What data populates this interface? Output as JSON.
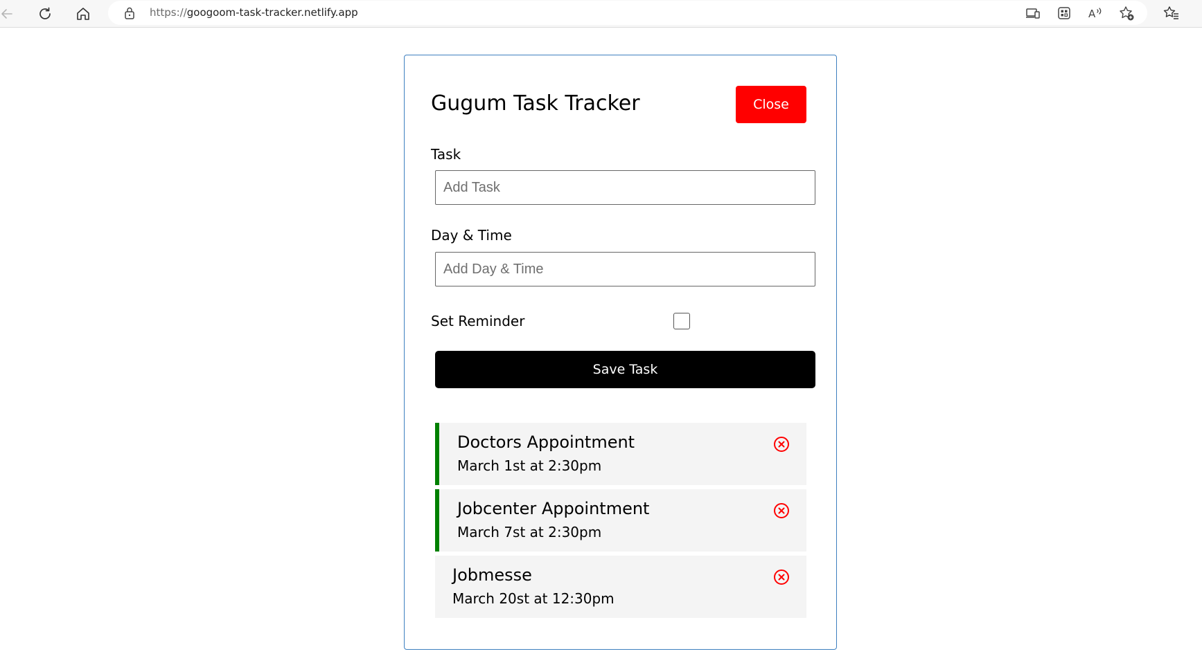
{
  "browser": {
    "url_scheme": "https://",
    "url_host": "googoom-task-tracker.netlify.app",
    "icons": [
      "back-icon",
      "refresh-icon",
      "home-icon",
      "lock-icon",
      "app-available-icon",
      "extensions-icon",
      "read-aloud-icon",
      "add-favorite-icon",
      "favorites-icon"
    ]
  },
  "header": {
    "title": "Gugum Task Tracker",
    "close_label": "Close"
  },
  "form": {
    "task_label": "Task",
    "task_placeholder": "Add Task",
    "day_label": "Day & Time",
    "day_placeholder": "Add Day & Time",
    "reminder_label": "Set Reminder",
    "reminder_checked": false,
    "save_label": "Save Task"
  },
  "tasks": [
    {
      "text": "Doctors Appointment",
      "day": "March 1st at 2:30pm",
      "reminder": true
    },
    {
      "text": "Jobcenter Appointment",
      "day": "March 7st at 2:30pm",
      "reminder": true
    },
    {
      "text": "Jobmesse",
      "day": "March 20st at 12:30pm",
      "reminder": false
    }
  ],
  "colors": {
    "close_button": "#ff0000",
    "save_button": "#000000",
    "reminder_border": "#008000",
    "delete_icon": "#ff0000",
    "card_border": "#3d7fbf",
    "task_background": "#f4f4f4"
  }
}
